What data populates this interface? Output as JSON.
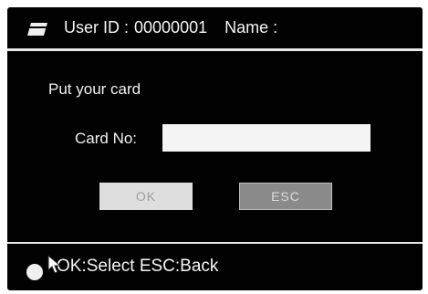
{
  "header": {
    "icon": "card-icon",
    "user_id_label": "User ID :",
    "user_id_value": "00000001",
    "name_label": "Name :",
    "name_value": ""
  },
  "main": {
    "prompt": "Put your card",
    "card_no_label": "Card No:",
    "card_no_value": "",
    "ok_label": "OK",
    "esc_label": "ESC"
  },
  "footer": {
    "hint": "OK:Select  ESC:Back"
  },
  "colors": {
    "screen_background": "#020202",
    "text": "#f5f5f5",
    "ok_button": "#dedede",
    "esc_button": "#8a8a8a"
  }
}
